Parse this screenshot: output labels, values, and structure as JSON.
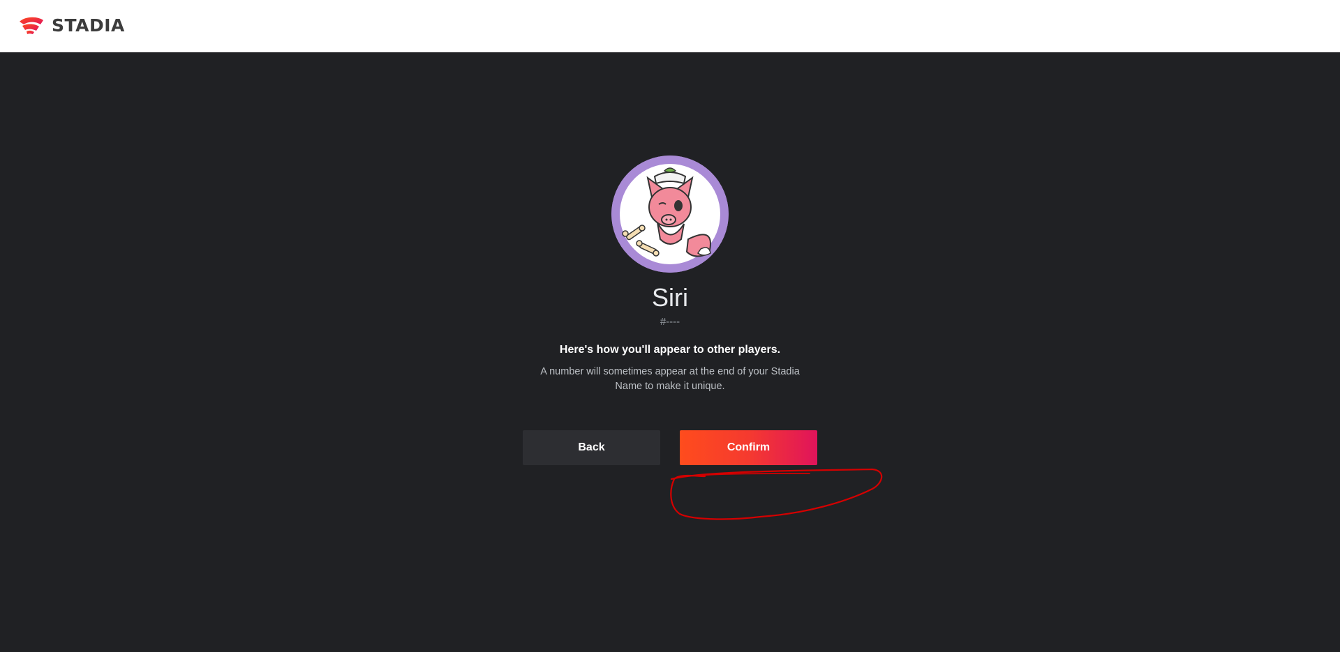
{
  "header": {
    "brand_name": "STADIA",
    "logo_colors": [
      "#ff4c1d",
      "#e0145b"
    ]
  },
  "profile": {
    "avatar_icon": "pink-fox-avatar-icon",
    "display_name": "Siri",
    "tag": "#----"
  },
  "message": {
    "heading": "Here's how you'll appear to other players.",
    "description": "A number will sometimes appear at the end of your Stadia Name to make it unique."
  },
  "actions": {
    "back_label": "Back",
    "confirm_label": "Confirm"
  },
  "colors": {
    "background": "#202124",
    "header_background": "#ffffff",
    "back_button": "#2d2e32",
    "confirm_gradient_start": "#ff4c1d",
    "confirm_gradient_end": "#e0145b",
    "annotation_stroke": "#d40000",
    "avatar_ring": "#a98ad6"
  }
}
